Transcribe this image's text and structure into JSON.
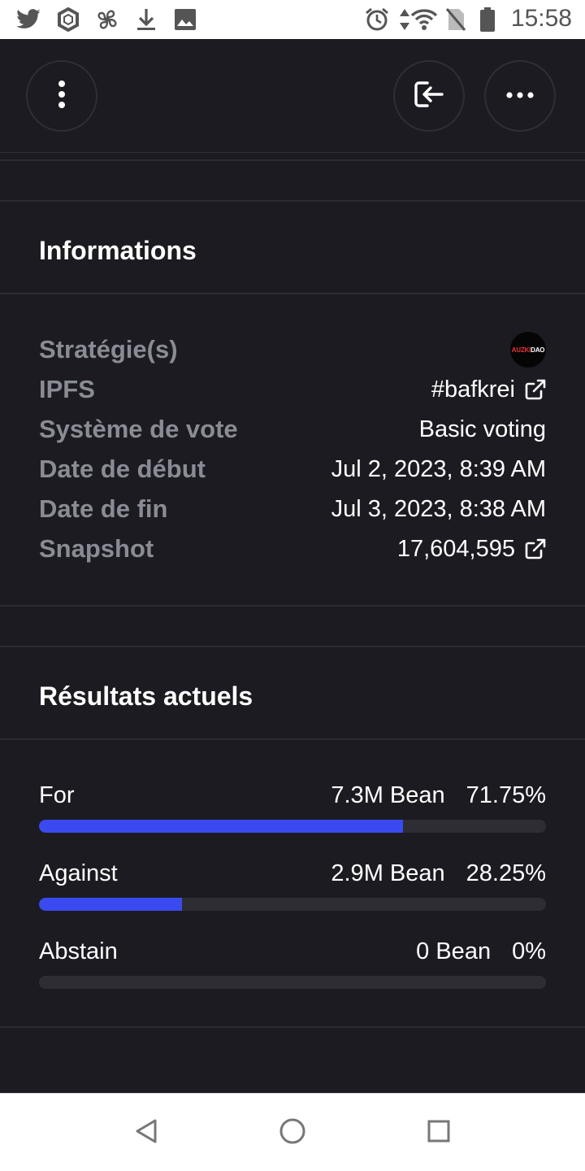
{
  "status_bar": {
    "time": "15:58",
    "left_icons": [
      "twitter-icon",
      "sync-app-icon",
      "pinwheel-icon",
      "download-icon",
      "image-icon"
    ],
    "right_icons": [
      "alarm-icon",
      "data-arrows-icon",
      "wifi-icon",
      "no-sim-icon",
      "battery-icon"
    ]
  },
  "top_bar": {
    "icons": [
      "vertical-dots-icon",
      "sign-in-icon",
      "horizontal-dots-icon"
    ]
  },
  "informations": {
    "title": "Informations",
    "rows": [
      {
        "label": "Stratégie(s)",
        "value": "AUZKIDAO",
        "avatar_red": "AUZKI",
        "avatar_white": "DAO"
      },
      {
        "label": "IPFS",
        "value": "#bafkrei"
      },
      {
        "label": "Système de vote",
        "value": "Basic voting"
      },
      {
        "label": "Date de début",
        "value": "Jul 2, 2023, 8:39 AM"
      },
      {
        "label": "Date de fin",
        "value": "Jul 3, 2023, 8:38 AM"
      },
      {
        "label": "Snapshot",
        "value": "17,604,595"
      }
    ]
  },
  "results": {
    "title": "Résultats actuels",
    "accent_color": "#3a4af0",
    "choices": [
      {
        "label": "For",
        "amount": "7.3M Bean",
        "percent": "71.75%",
        "fill": 0.7175
      },
      {
        "label": "Against",
        "amount": "2.9M Bean",
        "percent": "28.25%",
        "fill": 0.2825
      },
      {
        "label": "Abstain",
        "amount": "0 Bean",
        "percent": "0%",
        "fill": 0
      }
    ]
  }
}
